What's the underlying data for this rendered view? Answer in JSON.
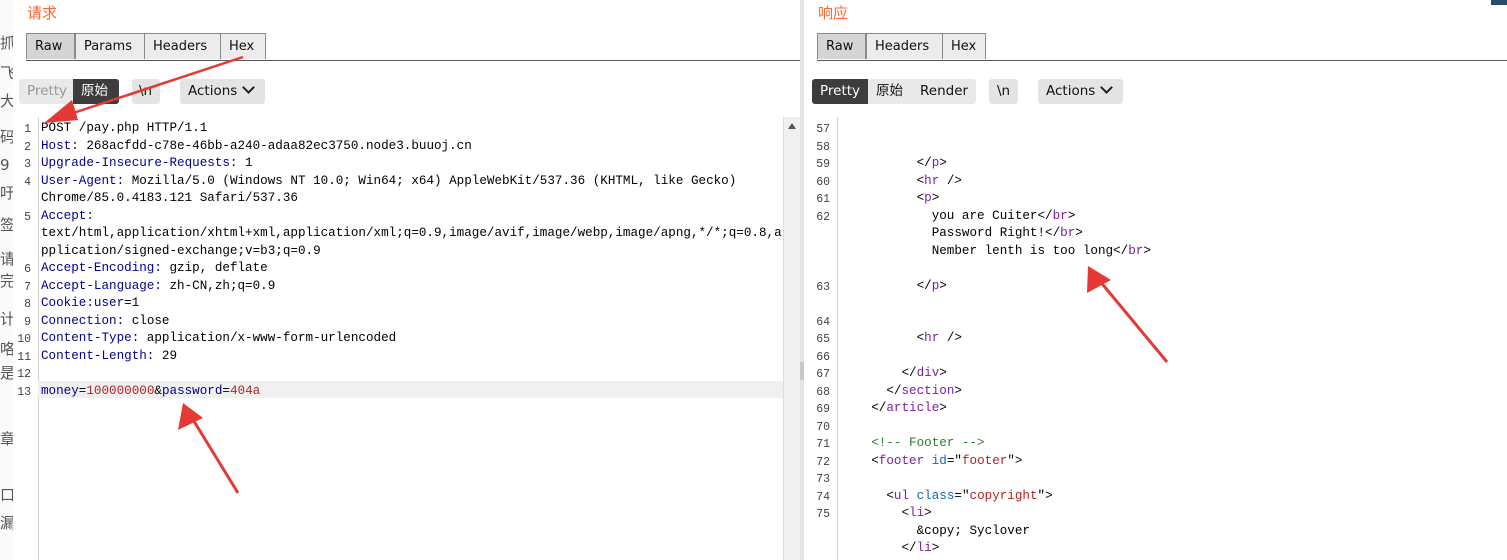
{
  "left_strip": [
    "抓",
    "飞",
    "大",
    "码",
    "9",
    "吁",
    "签",
    "请",
    "完",
    "计",
    "咯",
    "是",
    "章",
    "口",
    "漏"
  ],
  "request": {
    "title": "请求",
    "tabs": [
      "Raw",
      "Params",
      "Headers",
      "Hex"
    ],
    "toolbar": {
      "pretty": "Pretty",
      "raw": "原始",
      "newline": "\\n",
      "actions": "Actions"
    },
    "lines": [
      {
        "n": "1",
        "text": "POST /pay.php HTTP/1.1"
      },
      {
        "n": "2",
        "key": "Host:",
        "val": " 268acfdd-c78e-46bb-a240-adaa82ec3750.node3.buuoj.cn"
      },
      {
        "n": "3",
        "key": "Upgrade-Insecure-Requests:",
        "val": " 1"
      },
      {
        "n": "4",
        "key": "User-Agent:",
        "val": " Mozilla/5.0 (Windows NT 10.0; Win64; x64) AppleWebKit/537.36 (KHTML, like Gecko)"
      },
      {
        "n": "",
        "text": "Chrome/85.0.4183.121 Safari/537.36"
      },
      {
        "n": "5",
        "key": "Accept:",
        "val": ""
      },
      {
        "n": "",
        "text": "text/html,application/xhtml+xml,application/xml;q=0.9,image/avif,image/webp,image/apng,*/*;q=0.8,a"
      },
      {
        "n": "",
        "text": "pplication/signed-exchange;v=b3;q=0.9"
      },
      {
        "n": "6",
        "key": "Accept-Encoding:",
        "val": " gzip, deflate"
      },
      {
        "n": "7",
        "key": "Accept-Language:",
        "val": " zh-CN,zh;q=0.9"
      },
      {
        "n": "8",
        "key": "Cookie:",
        "val2k": "user",
        "val2v": "=1"
      },
      {
        "n": "9",
        "key": "Connection:",
        "val": " close"
      },
      {
        "n": "10",
        "key": "Content-Type:",
        "val": " application/x-www-form-urlencoded"
      },
      {
        "n": "11",
        "key": "Content-Length:",
        "val": " 29"
      },
      {
        "n": "12",
        "text": ""
      },
      {
        "n": "13",
        "body": true,
        "p1k": "money",
        "p1v": "100000000",
        "p2k": "password",
        "p2v": "404a"
      }
    ]
  },
  "response": {
    "title": "响应",
    "tabs": [
      "Raw",
      "Headers",
      "Hex"
    ],
    "toolbar": {
      "pretty": "Pretty",
      "raw": "原始",
      "render": "Render",
      "newline": "\\n",
      "actions": "Actions"
    },
    "lines": [
      {
        "n": "57",
        "html": ""
      },
      {
        "n": "58",
        "html": ""
      },
      {
        "n": "59",
        "html": "          &lt;/<span class='t'>p</span>&gt;"
      },
      {
        "n": "60",
        "html": "          &lt;<span class='t'>hr</span> /&gt;"
      },
      {
        "n": "61",
        "html": "          &lt;<span class='t'>p</span>&gt;"
      },
      {
        "n": "62",
        "html": "            you are Cuiter&lt;/<span class='t'>br</span>&gt;"
      },
      {
        "n": "",
        "html": "            Password Right!&lt;/<span class='t'>br</span>&gt;"
      },
      {
        "n": "",
        "html": "            Nember lenth is too long&lt;/<span class='t'>br</span>&gt;"
      },
      {
        "n": "",
        "html": ""
      },
      {
        "n": "63",
        "html": "          &lt;/<span class='t'>p</span>&gt;"
      },
      {
        "n": "",
        "html": ""
      },
      {
        "n": "64",
        "html": ""
      },
      {
        "n": "65",
        "html": "          &lt;<span class='t'>hr</span> /&gt;"
      },
      {
        "n": "66",
        "html": ""
      },
      {
        "n": "67",
        "html": "        &lt;/<span class='t'>div</span>&gt;"
      },
      {
        "n": "68",
        "html": "      &lt;/<span class='t'>section</span>&gt;"
      },
      {
        "n": "69",
        "html": "    &lt;/<span class='t'>article</span>&gt;"
      },
      {
        "n": "70",
        "html": ""
      },
      {
        "n": "71",
        "html": "    <span class='c'>&lt;!-- Footer --&gt;</span>"
      },
      {
        "n": "72",
        "html": "    &lt;<span class='t'>footer</span> <span class='a'>id</span>=&quot;<span class='v'>footer</span>&quot;&gt;"
      },
      {
        "n": "73",
        "html": ""
      },
      {
        "n": "74",
        "html": "      &lt;<span class='t'>ul</span> <span class='a'>class</span>=&quot;<span class='v'>copyright</span>&quot;&gt;"
      },
      {
        "n": "75",
        "html": "        &lt;<span class='t'>li</span>&gt;"
      },
      {
        "n": "",
        "html": "          &amp;copy; Syclover"
      },
      {
        "n": "",
        "html": "        &lt;/<span class='t'>li</span>&gt;"
      }
    ]
  },
  "colors": {
    "accent": "#ff6633",
    "active_toggle": "#3d3d3d",
    "arrow": "#e53935"
  }
}
